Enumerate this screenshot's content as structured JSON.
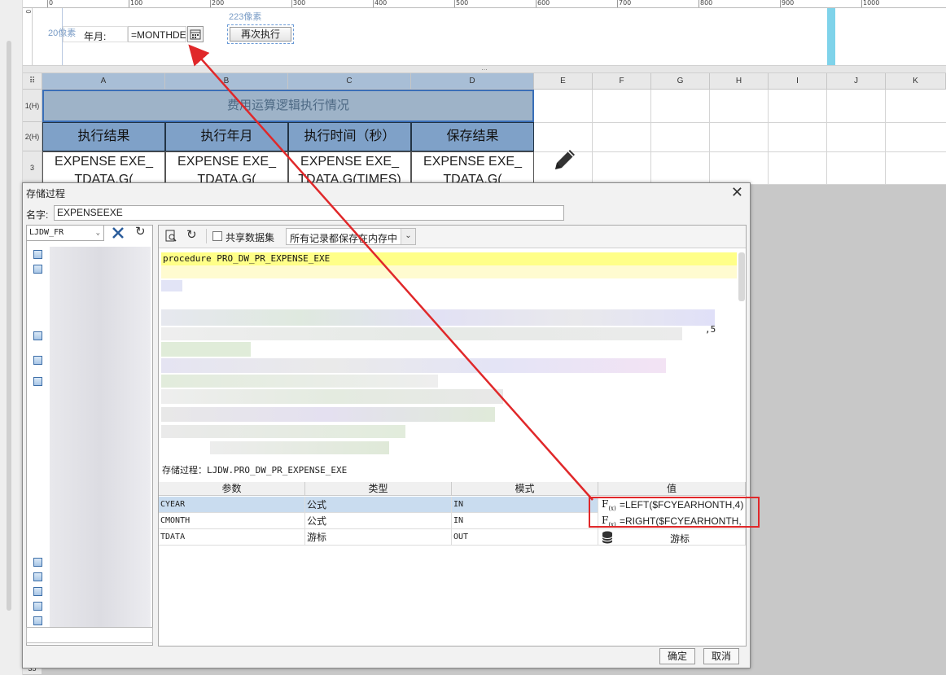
{
  "ruler": {
    "labels": [
      "0",
      "100",
      "200",
      "300",
      "400",
      "500",
      "600",
      "700",
      "800",
      "900",
      "1000"
    ],
    "side_label": "0"
  },
  "params": {
    "left_margin_label": "20像素",
    "top_margin_label": "223像素",
    "year_month_label": "年月:",
    "date_value": "=MONTHDE",
    "run_button": "再次执行"
  },
  "splitter_label": "…",
  "sheet": {
    "columns": [
      "A",
      "B",
      "C",
      "D",
      "E",
      "F",
      "G",
      "H",
      "I",
      "J",
      "K"
    ],
    "rows": [
      "1(H)",
      "2(H)",
      "3"
    ],
    "last_row": "35",
    "title": "费用运算逻辑执行情况",
    "headers": [
      "执行结果",
      "执行年月",
      "执行时间（秒）",
      "保存结果"
    ],
    "data_cells": [
      "EXPENSE EXE_ TDATA.G(",
      "EXPENSE EXE_ TDATA.G(",
      "EXPENSE EXE_ TDATA.G(TIMES)",
      "EXPENSE EXE_ TDATA.G("
    ],
    "edit_icon": "pencil-icon"
  },
  "dialog": {
    "title": "存储过程",
    "close": "✕",
    "name_label": "名字:",
    "name_value": "EXPENSEEXE",
    "connection": "LJDW_FR",
    "share_dataset": "共享数据集",
    "memory_option": "所有记录都保存在内存中",
    "sql_first_line": "procedure PRO_DW_PR_EXPENSE_EXE",
    "sql_fragment": ",5",
    "proc_label": "存储过程：LJDW.PRO_DW_PR_EXPENSE_EXE",
    "table": {
      "headers": [
        "参数",
        "类型",
        "模式",
        "值"
      ],
      "rows": [
        {
          "param": "CYEAR",
          "type": "公式",
          "mode": "IN",
          "value": "=LEFT($FCYEARHONTH,4)",
          "selected": true
        },
        {
          "param": "CMONTH",
          "type": "公式",
          "mode": "IN",
          "value": "=RIGHT($FCYEARHONTH,",
          "selected": false
        },
        {
          "param": "TDATA",
          "type": "游标",
          "mode": "OUT",
          "value": "游标",
          "selected": false
        }
      ]
    },
    "ok_button": "确定",
    "cancel_button": "取消"
  },
  "colors": {
    "title_bg": "#9eb3c8",
    "header_bg": "#7fa1c8",
    "highlight_row": "#c9dcef",
    "annotation_red": "#e0282a",
    "sql_highlight": "#ffff88"
  }
}
